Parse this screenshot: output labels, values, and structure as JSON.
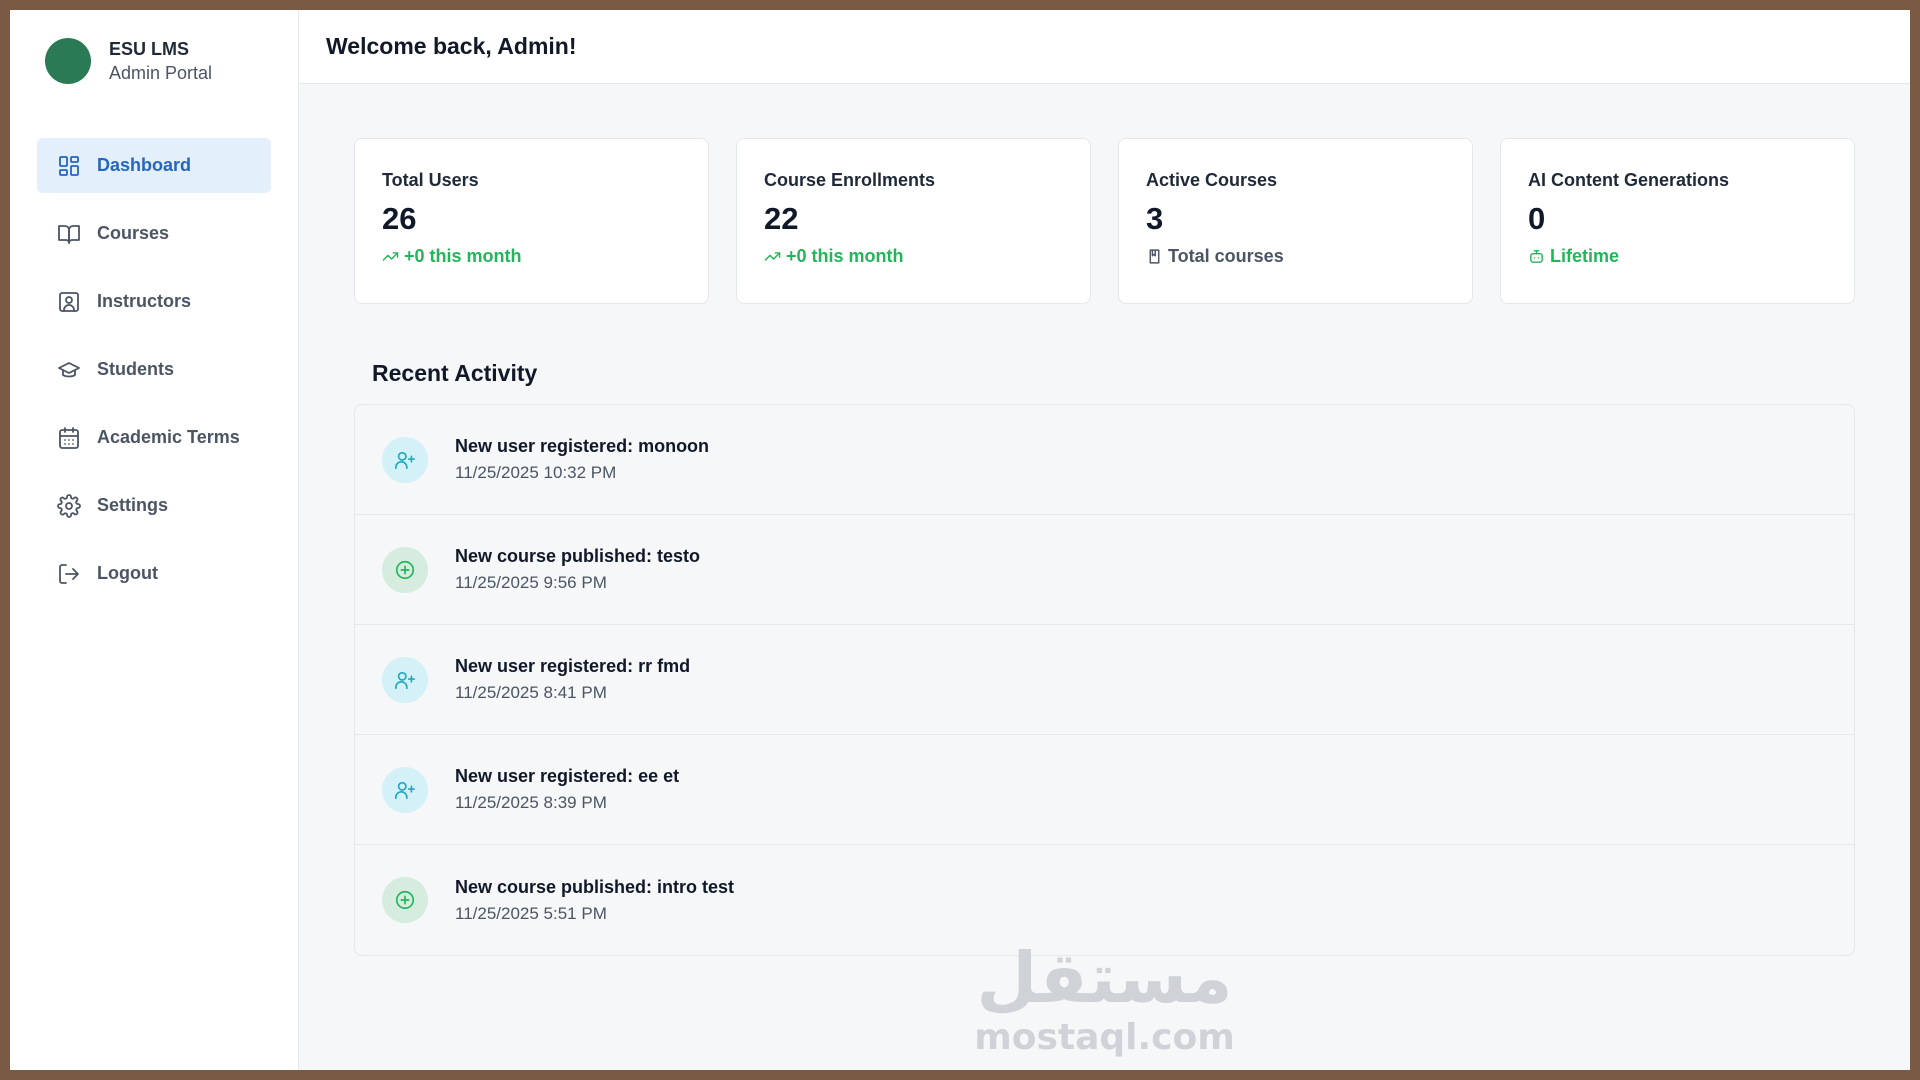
{
  "brand": {
    "name": "ESU LMS",
    "subtitle": "Admin Portal",
    "logo_color": "#2a7a55"
  },
  "sidebar": {
    "items": [
      {
        "label": "Dashboard",
        "icon": "dashboard-icon",
        "active": true
      },
      {
        "label": "Courses",
        "icon": "book-icon"
      },
      {
        "label": "Instructors",
        "icon": "instructor-icon"
      },
      {
        "label": "Students",
        "icon": "graduation-cap-icon"
      },
      {
        "label": "Academic Terms",
        "icon": "calendar-icon"
      },
      {
        "label": "Settings",
        "icon": "gear-icon"
      },
      {
        "label": "Logout",
        "icon": "logout-icon"
      }
    ]
  },
  "header": {
    "welcome": "Welcome back, Admin!"
  },
  "stats": [
    {
      "label": "Total Users",
      "value": "26",
      "foot": "+0 this month",
      "foot_icon": "trending-up-icon"
    },
    {
      "label": "Course Enrollments",
      "value": "22",
      "foot": "+0 this month",
      "foot_icon": "trending-up-icon"
    },
    {
      "label": "Active Courses",
      "value": "3",
      "foot": "Total courses",
      "foot_icon": "book-small-icon"
    },
    {
      "label": "AI Content Generations",
      "value": "0",
      "foot": "Lifetime",
      "foot_icon": "robot-icon"
    }
  ],
  "recent_activity": {
    "title": "Recent Activity",
    "items": [
      {
        "type": "user",
        "icon": "user-plus-icon",
        "title": "New user registered: monoon",
        "time": "11/25/2025 10:32 PM"
      },
      {
        "type": "course",
        "icon": "plus-circle-icon",
        "title": "New course published: testo",
        "time": "11/25/2025 9:56 PM"
      },
      {
        "type": "user",
        "icon": "user-plus-icon",
        "title": "New user registered: rr fmd",
        "time": "11/25/2025 8:41 PM"
      },
      {
        "type": "user",
        "icon": "user-plus-icon",
        "title": "New user registered: ee et",
        "time": "11/25/2025 8:39 PM"
      },
      {
        "type": "course",
        "icon": "plus-circle-icon",
        "title": "New course published: intro test",
        "time": "11/25/2025 5:51 PM"
      }
    ]
  },
  "watermark": {
    "arabic": "مستقل",
    "latin": "mostaql.com"
  },
  "colors": {
    "accent": "#2566c0",
    "active_bg": "#e3effb",
    "success": "#22b55a",
    "info": "#1fa8c4"
  }
}
